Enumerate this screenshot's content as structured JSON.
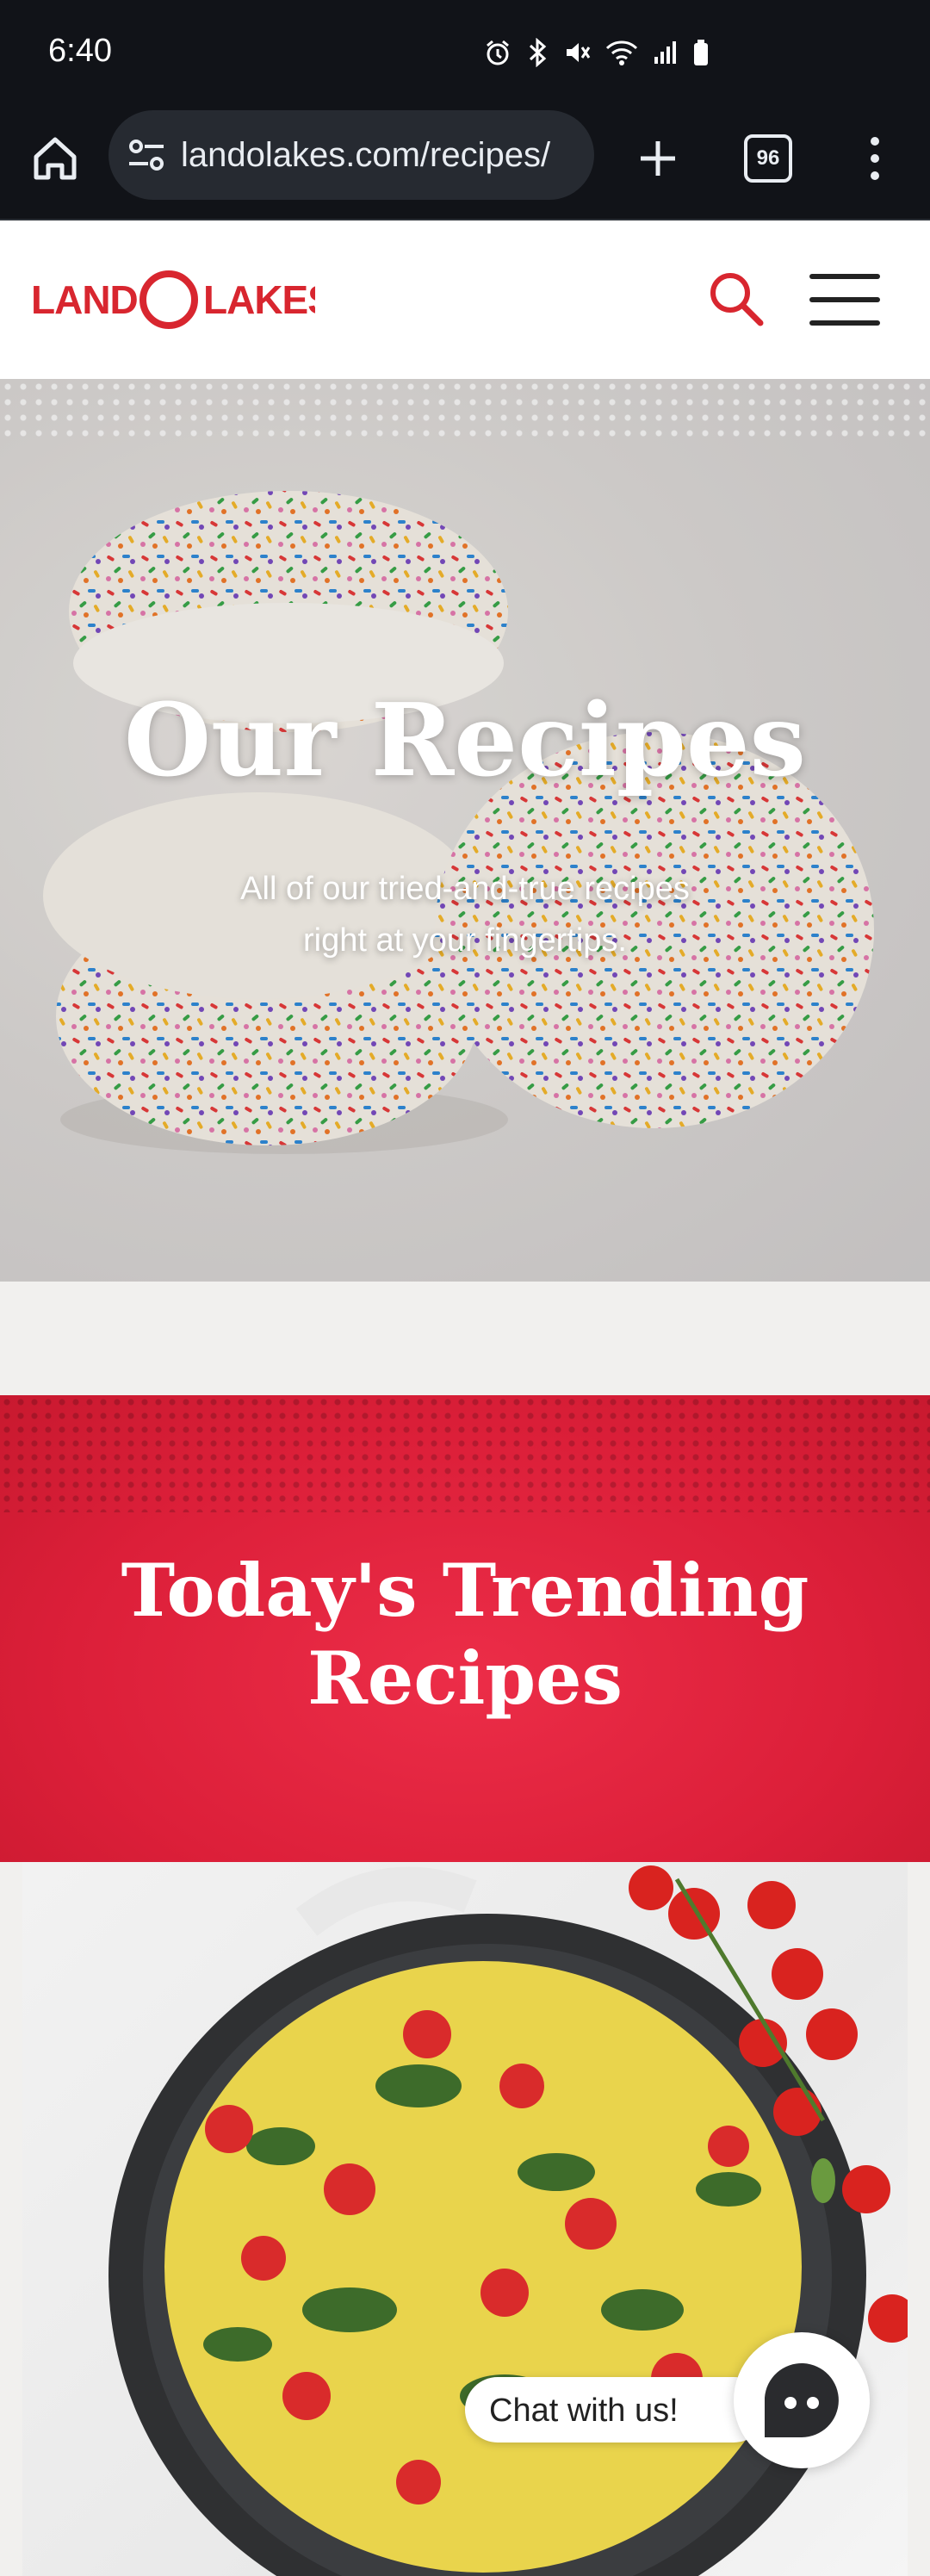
{
  "status_bar": {
    "time": "6:40",
    "icons": [
      "alarm-icon",
      "bluetooth-icon",
      "mute-icon",
      "wifi-icon",
      "signal-icon",
      "battery-icon"
    ]
  },
  "browser": {
    "url": "landolakes.com/recipes/",
    "tab_count": "96"
  },
  "header": {
    "logo_text": "LAND O LAKES",
    "brand_color": "#d8262f"
  },
  "hero": {
    "title": "Our Recipes",
    "subtitle": "All of our tried-and-true recipes right at your fingertips."
  },
  "trending": {
    "title": "Today's Trending Recipes",
    "bg_color": "#e2223b"
  },
  "chat": {
    "label": "Chat with us!"
  }
}
